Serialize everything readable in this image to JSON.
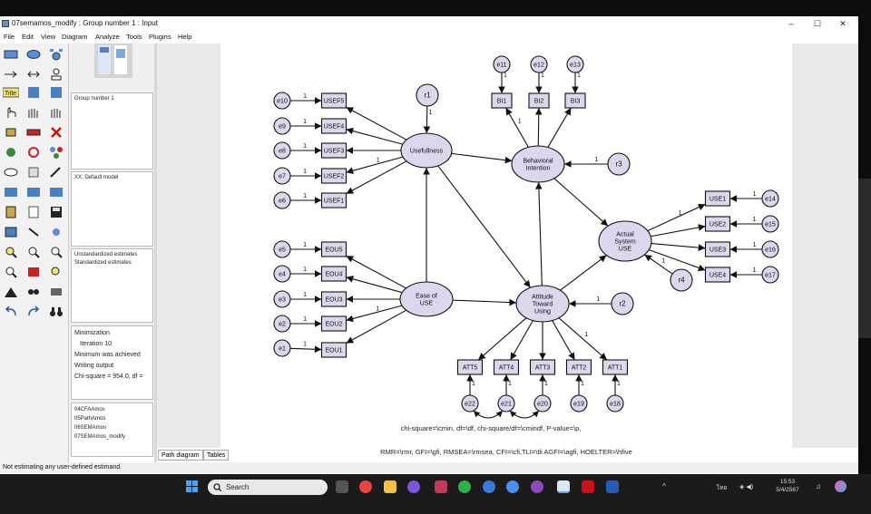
{
  "window": {
    "title": "07semamos_modify : Group number 1 : Input",
    "controls": [
      "–",
      "☐",
      "✕"
    ]
  },
  "menu": [
    "File",
    "Edit",
    "View",
    "Diagram",
    "Analyze",
    "Tools",
    "Plugins",
    "Help"
  ],
  "panel": {
    "group": "Group number 1",
    "model": "XX: Default model",
    "estimates": [
      "Unstandardized estimates",
      "Standardized estimates"
    ],
    "log": [
      "Minimization",
      "Iteration 10",
      "Minimum was achieved",
      "Writing output",
      "Chi-square = 954.0, df ="
    ],
    "files": [
      "04CFAAmos",
      "05PathAmos",
      "06SEMAmos",
      "07SEMAmos_modify"
    ]
  },
  "diagram": {
    "latents": [
      {
        "id": "usefulness",
        "label": [
          "Usefullness"
        ]
      },
      {
        "id": "behavioral",
        "label": [
          "Behavioral",
          "Intention"
        ]
      },
      {
        "id": "actual",
        "label": [
          "Actual",
          "System",
          "USE"
        ]
      },
      {
        "id": "ease",
        "label": [
          "Ease of",
          "USE"
        ]
      },
      {
        "id": "attitude",
        "label": [
          "Attitude",
          "Toward",
          "Using"
        ]
      }
    ],
    "observed": [
      "USEF5",
      "USEF4",
      "USEF3",
      "USEF2",
      "USEF1",
      "EOU5",
      "EOU4",
      "EOU3",
      "EOU2",
      "EOU1",
      "BI1",
      "BI2",
      "BI3",
      "USE1",
      "USE2",
      "USE3",
      "USE4",
      "ATT5",
      "ATT4",
      "ATT3",
      "ATT2",
      "ATT1"
    ],
    "errors": [
      "e10",
      "e9",
      "e8",
      "e7",
      "e6",
      "e5",
      "e4",
      "e3",
      "e2",
      "e1",
      "e11",
      "e12",
      "e13",
      "e14",
      "e15",
      "e16",
      "e17",
      "e22",
      "e21",
      "e20",
      "e19",
      "e18"
    ],
    "residuals": [
      "r1",
      "r2",
      "r3",
      "r4"
    ],
    "path_label": "1",
    "fit_line1": "chi-square=\\cmin, df=\\df, chi-square/df=\\cmindf, P-value=\\p,",
    "fit_line2": "RMR=\\rmr, GFI=\\gfi, RMSEA=\\rmsea, CFI=\\cfi,TLI=\\tli AGFI=\\agfi, HOELTER=\\hfive"
  },
  "tabs": [
    "Path diagram",
    "Tables"
  ],
  "status": "Not estimating any user-defined estimand.",
  "taskbar": {
    "search_label": "Search",
    "time": "15:53",
    "date": "5/4/2567",
    "lang": "ไทย"
  }
}
